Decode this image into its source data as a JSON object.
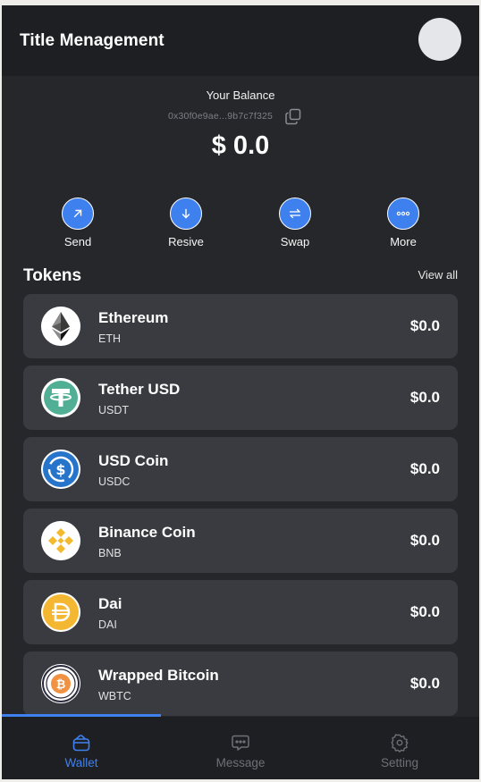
{
  "header": {
    "title": "Title Menagement"
  },
  "balance": {
    "label": "Your Balance",
    "address": "0x30f0e9ae...9b7c7f325",
    "amount": "$ 0.0"
  },
  "actions": [
    {
      "label": "Send",
      "icon": "arrow-up-right-icon"
    },
    {
      "label": "Resive",
      "icon": "arrow-down-icon"
    },
    {
      "label": "Swap",
      "icon": "swap-icon"
    },
    {
      "label": "More",
      "icon": "more-icon"
    }
  ],
  "tokens_section": {
    "title": "Tokens",
    "view_all": "View all"
  },
  "tokens": [
    {
      "name": "Ethereum",
      "symbol": "ETH",
      "value": "$0.0",
      "icon": "ethereum-icon"
    },
    {
      "name": "Tether USD",
      "symbol": "USDT",
      "value": "$0.0",
      "icon": "tether-icon"
    },
    {
      "name": "USD Coin",
      "symbol": "USDC",
      "value": "$0.0",
      "icon": "usd-coin-icon"
    },
    {
      "name": "Binance Coin",
      "symbol": "BNB",
      "value": "$0.0",
      "icon": "binance-icon"
    },
    {
      "name": "Dai",
      "symbol": "DAI",
      "value": "$0.0",
      "icon": "dai-icon"
    },
    {
      "name": "Wrapped Bitcoin",
      "symbol": "WBTC",
      "value": "$0.0",
      "icon": "bitcoin-icon"
    }
  ],
  "nav": [
    {
      "label": "Wallet",
      "icon": "wallet-icon",
      "active": true
    },
    {
      "label": "Message",
      "icon": "message-icon",
      "active": false
    },
    {
      "label": "Setting",
      "icon": "settings-icon",
      "active": false
    }
  ],
  "colors": {
    "accent": "#3f80ef",
    "background": "#26272b",
    "header": "#1e1f23",
    "card": "#3a3b41"
  }
}
